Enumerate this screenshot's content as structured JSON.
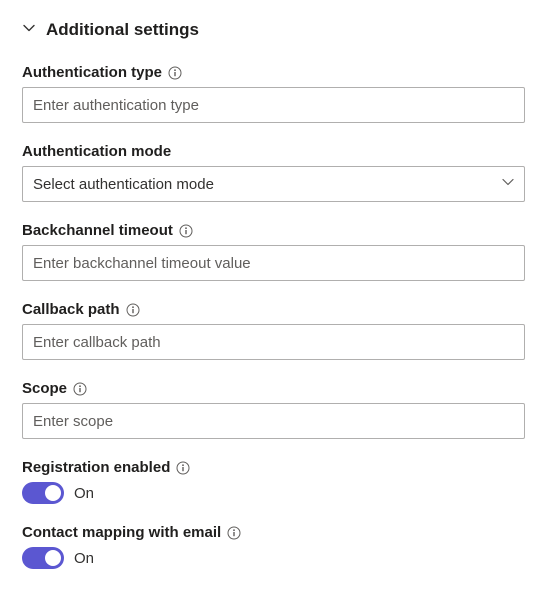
{
  "section": {
    "title": "Additional settings"
  },
  "fields": {
    "auth_type": {
      "label": "Authentication type",
      "placeholder": "Enter authentication type",
      "value": ""
    },
    "auth_mode": {
      "label": "Authentication mode",
      "placeholder": "Select authentication mode",
      "value": ""
    },
    "backchannel_timeout": {
      "label": "Backchannel timeout",
      "placeholder": "Enter backchannel timeout value",
      "value": ""
    },
    "callback_path": {
      "label": "Callback path",
      "placeholder": "Enter callback path",
      "value": ""
    },
    "scope": {
      "label": "Scope",
      "placeholder": "Enter scope",
      "value": ""
    },
    "registration_enabled": {
      "label": "Registration enabled",
      "on": true,
      "state_label": "On"
    },
    "contact_mapping": {
      "label": "Contact mapping with email",
      "on": true,
      "state_label": "On"
    }
  }
}
